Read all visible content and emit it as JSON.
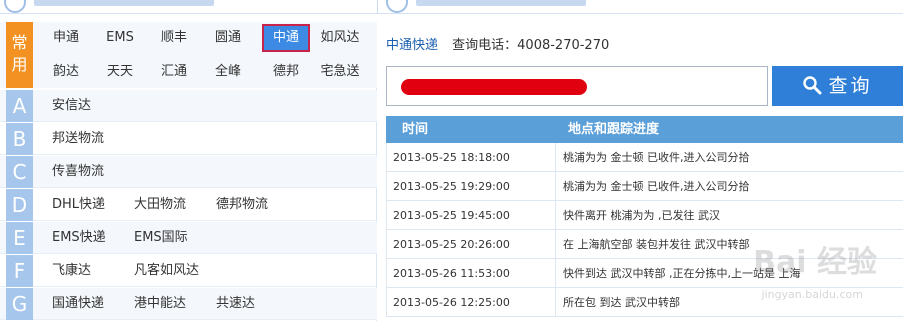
{
  "common": {
    "tag": "常用",
    "row1": [
      "申通",
      "EMS",
      "顺丰",
      "圆通",
      "中通",
      "如风达"
    ],
    "row2": [
      "韵达",
      "天天",
      "汇通",
      "全峰",
      "德邦",
      "宅急送"
    ],
    "selected": "中通"
  },
  "letters": [
    {
      "letter": "A",
      "items": [
        "安信达"
      ]
    },
    {
      "letter": "B",
      "items": [
        "邦送物流"
      ]
    },
    {
      "letter": "C",
      "items": [
        "传喜物流"
      ]
    },
    {
      "letter": "D",
      "items": [
        "DHL快递",
        "大田物流",
        "德邦物流"
      ]
    },
    {
      "letter": "E",
      "items": [
        "EMS快递",
        "EMS国际"
      ]
    },
    {
      "letter": "F",
      "items": [
        "飞康达",
        "凡客如风达"
      ]
    },
    {
      "letter": "G",
      "items": [
        "国通快递",
        "港中能达",
        "共速达"
      ]
    }
  ],
  "info": {
    "company": "中通快递",
    "phone_label": "查询电话：4008-270-270"
  },
  "search": {
    "button_label": "查询"
  },
  "table": {
    "headers": [
      "时间",
      "地点和跟踪进度"
    ],
    "rows": [
      [
        "2013-05-25 18:18:00",
        "桃浦为为 金士顿 已收件,进入公司分拾"
      ],
      [
        "2013-05-25 19:29:00",
        "桃浦为为 金士顿 已收件,进入公司分拾"
      ],
      [
        "2013-05-25 19:45:00",
        "快件离开 桃浦为为 ,已发往 武汉"
      ],
      [
        "2013-05-25 20:26:00",
        "在 上海航空部 装包并发往 武汉中转部"
      ],
      [
        "2013-05-26 11:53:00",
        "快件到达 武汉中转部 ,正在分拣中,上一站是 上海"
      ],
      [
        "2013-05-26 12:25:00",
        "所在包 到达 武汉中转部"
      ]
    ]
  },
  "watermark": {
    "main": "Bai 经验",
    "sub": "jingyan.baidu.com"
  }
}
